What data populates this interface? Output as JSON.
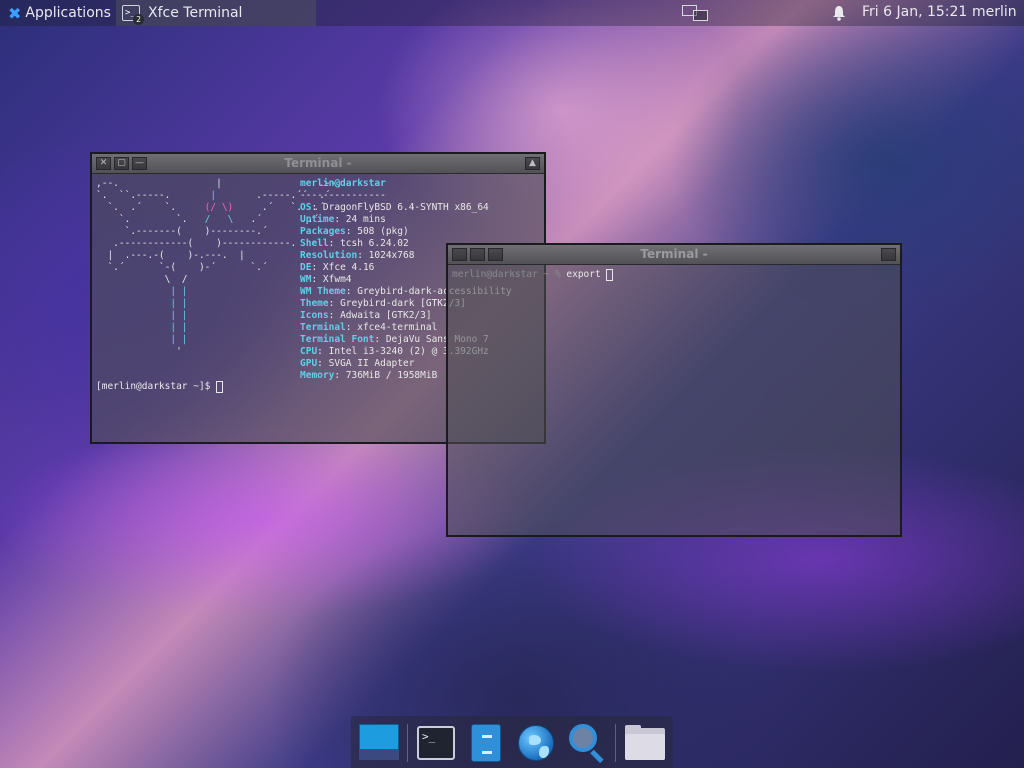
{
  "top_panel": {
    "applications_label": "Applications",
    "task_label": "Xfce Terminal",
    "task_badge": "2",
    "clock": "Fri  6 Jan, 15:21",
    "user": "merlin"
  },
  "window1": {
    "title": "Terminal -",
    "buttons": {
      "close": "✕",
      "max": "▢",
      "min": "—",
      "shade": "▲"
    },
    "neofetch": {
      "header": "merlin@darkstar",
      "separator": "---------------",
      "rows": [
        {
          "key": "OS",
          "value": "DragonFlyBSD 6.4-SYNTH x86_64"
        },
        {
          "key": "Uptime",
          "value": "24 mins"
        },
        {
          "key": "Packages",
          "value": "508 (pkg)"
        },
        {
          "key": "Shell",
          "value": "tcsh 6.24.02"
        },
        {
          "key": "Resolution",
          "value": "1024x768"
        },
        {
          "key": "DE",
          "value": "Xfce 4.16"
        },
        {
          "key": "WM",
          "value": "Xfwm4"
        },
        {
          "key": "WM Theme",
          "value": "Greybird-dark-accessibility"
        },
        {
          "key": "Theme",
          "value": "Greybird-dark [GTK2/3]"
        },
        {
          "key": "Icons",
          "value": "Adwaita [GTK2/3]"
        },
        {
          "key": "Terminal",
          "value": "xfce4-terminal"
        },
        {
          "key": "Terminal Font",
          "value": "DejaVu Sans Mono 7"
        },
        {
          "key": "CPU",
          "value": "Intel i3-3240 (2) @ 3.392GHz"
        },
        {
          "key": "GPU",
          "value": "SVGA II Adapter"
        },
        {
          "key": "Memory",
          "value": "736MiB / 1958MiB"
        }
      ]
    },
    "prompt": "[merlin@darkstar ~]$ "
  },
  "window2": {
    "title": "Terminal -",
    "prompt": "merlin@darkstar ~ % ",
    "command": "export "
  },
  "dock": {
    "items": [
      "desktop",
      "terminal",
      "file-manager",
      "web-browser",
      "app-finder",
      "home-folder"
    ],
    "terminal_glyph": ">_"
  },
  "colors": {
    "label_cyan": "#5fd0e8",
    "accent_pink": "#ff5fbf",
    "dock_blue": "#2f8fd8"
  }
}
